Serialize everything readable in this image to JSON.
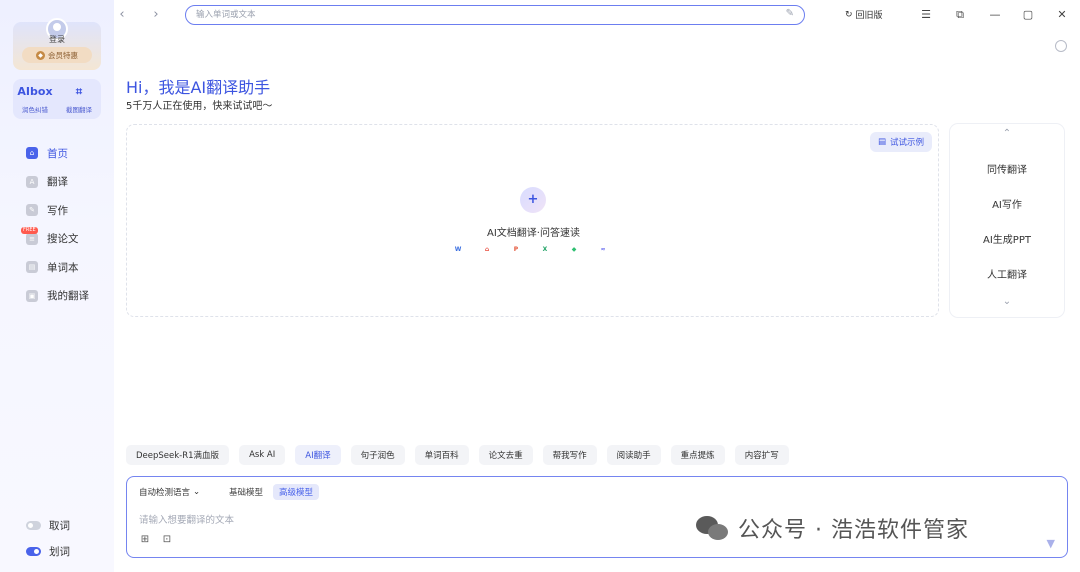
{
  "sidebar": {
    "login_label": "登录",
    "vip_label": "会员特惠",
    "tools": [
      {
        "icon": "AIbox",
        "label": "润色纠错"
      },
      {
        "icon": "⌗",
        "label": "截图翻译"
      }
    ],
    "nav": [
      {
        "label": "首页",
        "icon": "home-icon",
        "active": true
      },
      {
        "label": "翻译",
        "icon": "translate-icon",
        "active": false
      },
      {
        "label": "写作",
        "icon": "write-icon",
        "active": false
      },
      {
        "label": "搜论文",
        "icon": "paper-icon",
        "active": false,
        "badge": "FREE"
      },
      {
        "label": "单词本",
        "icon": "wordbook-icon",
        "active": false
      },
      {
        "label": "我的翻译",
        "icon": "my-translation-icon",
        "active": false
      }
    ],
    "toggles": [
      {
        "label": "取词",
        "on": false
      },
      {
        "label": "划词",
        "on": true
      }
    ]
  },
  "topbar": {
    "search_placeholder": "输入单词或文本",
    "old_version_label": "回旧版"
  },
  "hero": {
    "title": "Hi，我是AI翻译助手",
    "subtitle": "5千万人正在使用，快来试试吧～"
  },
  "doc_card": {
    "try_example": "试试示例",
    "label": "AI文档翻译·问答速读",
    "file_types": [
      {
        "glyph": "W",
        "color": "#3b6fe0"
      },
      {
        "glyph": "⌂",
        "color": "#e84b3c"
      },
      {
        "glyph": "P",
        "color": "#e4573b"
      },
      {
        "glyph": "X",
        "color": "#21a366"
      },
      {
        "glyph": "◆",
        "color": "#2fbf71"
      },
      {
        "glyph": "≈",
        "color": "#6b6ff0"
      }
    ]
  },
  "features": [
    "同传翻译",
    "AI写作",
    "AI生成PPT",
    "人工翻译"
  ],
  "chips": [
    {
      "label": "DeepSeek-R1满血版",
      "active": false
    },
    {
      "label": "Ask AI",
      "active": false
    },
    {
      "label": "AI翻译",
      "active": true
    },
    {
      "label": "句子润色",
      "active": false
    },
    {
      "label": "单词百科",
      "active": false
    },
    {
      "label": "论文去重",
      "active": false
    },
    {
      "label": "帮我写作",
      "active": false
    },
    {
      "label": "阅读助手",
      "active": false
    },
    {
      "label": "重点提炼",
      "active": false
    },
    {
      "label": "内容扩写",
      "active": false
    }
  ],
  "input": {
    "lang_label": "自动检测语言",
    "model_basic": "基础模型",
    "model_advanced": "高级模型",
    "placeholder": "请输入想要翻译的文本"
  },
  "watermark": "公众号 · 浩浩软件管家",
  "colors": {
    "accent": "#3d55e0",
    "sidebar_bg": "#f3f4ff"
  }
}
